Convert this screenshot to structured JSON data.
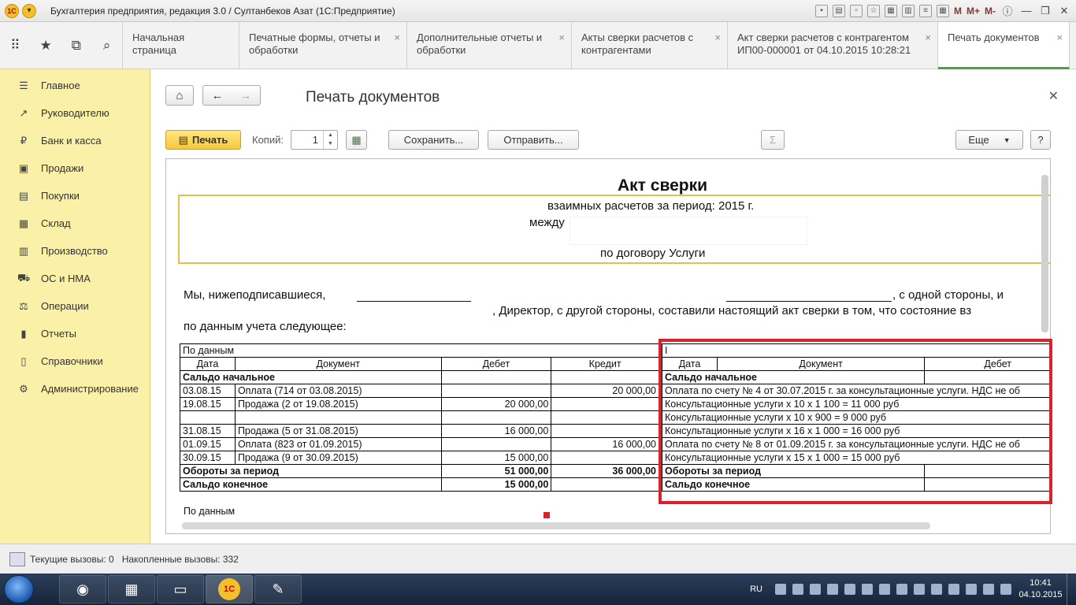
{
  "window": {
    "title": "Бухгалтерия предприятия, редакция 3.0 / Султанбеков Азат  (1С:Предприятие)",
    "title_icons": [
      "save-icon",
      "print-icon",
      "preview-icon",
      "favorite-icon",
      "bookmark-icon",
      "calendar-icon",
      "notes-icon",
      "calculator-icon"
    ],
    "m_buttons": [
      "M",
      "M+",
      "M-"
    ]
  },
  "tabs": [
    {
      "label": "Начальная страница",
      "closable": false
    },
    {
      "label": "Печатные формы, отчеты и обработки",
      "closable": true
    },
    {
      "label": "Дополнительные отчеты и обработки",
      "closable": true
    },
    {
      "label": "Акты сверки расчетов с контрагентами",
      "closable": true
    },
    {
      "label": "Акт сверки расчетов с контрагентом ИП00-000001 от 04.10.2015 10:28:21",
      "closable": true
    },
    {
      "label": "Печать документов",
      "closable": true,
      "active": true
    }
  ],
  "sidebar": {
    "items": [
      {
        "label": "Главное",
        "icon": "menu-icon"
      },
      {
        "label": "Руководителю",
        "icon": "trend-icon"
      },
      {
        "label": "Банк и касса",
        "icon": "ruble-icon"
      },
      {
        "label": "Продажи",
        "icon": "sales-icon"
      },
      {
        "label": "Покупки",
        "icon": "cart-icon"
      },
      {
        "label": "Склад",
        "icon": "warehouse-icon"
      },
      {
        "label": "Производство",
        "icon": "production-icon"
      },
      {
        "label": "ОС и НМА",
        "icon": "truck-icon"
      },
      {
        "label": "Операции",
        "icon": "operations-icon"
      },
      {
        "label": "Отчеты",
        "icon": "reports-icon"
      },
      {
        "label": "Справочники",
        "icon": "books-icon"
      },
      {
        "label": "Администрирование",
        "icon": "gear-icon"
      }
    ]
  },
  "page": {
    "title": "Печать документов",
    "print_label": "Печать",
    "copies_label": "Копий:",
    "copies_value": "1",
    "save_label": "Сохранить...",
    "send_label": "Отправить...",
    "more_label": "Еще",
    "help_label": "?"
  },
  "document": {
    "title": "Акт сверки",
    "subtitle": "взаимных расчетов за период: 2015 г.",
    "between": "между",
    "contract": "по договору Услуги",
    "intro_line1_a": "Мы,  нижеподписавшиеся,",
    "intro_line1_b": ",  с  одной  стороны,  и",
    "intro_line2": ", Директор, с другой стороны, составили настоящий акт сверки в том, что состояние вз",
    "intro_line3": "по данным учета следующее:",
    "left_header": "По данным",
    "right_header": "I",
    "columns_left": [
      "Дата",
      "Документ",
      "Дебет",
      "Кредит"
    ],
    "columns_right": [
      "Дата",
      "Документ",
      "Дебет"
    ],
    "opening": "Сальдо начальное",
    "turnover": "Обороты за период",
    "closing": "Сальдо конечное",
    "rows": [
      {
        "date": "03.08.15",
        "doc": "Оплата (714 от 03.08.2015)",
        "debit": "",
        "credit": "20 000,00",
        "right": "Оплата по счету № 4 от 30.07.2015 г. за консультационные услуги. НДС не об"
      },
      {
        "date": "19.08.15",
        "doc": "Продажа (2 от 19.08.2015)",
        "debit": "20 000,00",
        "credit": "",
        "right": "Консультационные услуги х 10 х 1 100 = 11 000 руб"
      },
      {
        "date": "",
        "doc": "",
        "debit": "",
        "credit": "",
        "right": "Консультационные услуги х 10 х 900 = 9 000 руб"
      },
      {
        "date": "31.08.15",
        "doc": "Продажа (5 от 31.08.2015)",
        "debit": "16 000,00",
        "credit": "",
        "right": "Консультационные услуги х 16 х 1 000 = 16 000 руб"
      },
      {
        "date": "01.09.15",
        "doc": "Оплата (823 от 01.09.2015)",
        "debit": "",
        "credit": "16 000,00",
        "right": "Оплата по счету № 8 от 01.09.2015 г. за консультационные услуги. НДС не об"
      },
      {
        "date": "30.09.15",
        "doc": "Продажа (9 от 30.09.2015)",
        "debit": "15 000,00",
        "credit": "",
        "right": "Консультационные услуги х 15 х 1 000 = 15 000 руб"
      }
    ],
    "turnover_debit": "51 000,00",
    "turnover_credit": "36 000,00",
    "closing_debit": "15 000,00",
    "footer": "По данным"
  },
  "status": {
    "current_calls": "Текущие вызовы: 0",
    "accumulated_calls": "Накопленные вызовы: 332"
  },
  "taskbar": {
    "lang": "RU",
    "time": "10:41",
    "date": "04.10.2015",
    "apps": [
      "chrome-icon",
      "calculator-icon",
      "explorer-icon",
      "1c-icon",
      "paint-icon"
    ],
    "app_1c_label": "1С"
  },
  "colors": {
    "sidebar_bg": "#faf0a8",
    "accent_green": "#4aa247",
    "print_button": "#f5c93d",
    "highlight_red": "#d9222a",
    "doc_border_yellow": "#e0c24a"
  }
}
